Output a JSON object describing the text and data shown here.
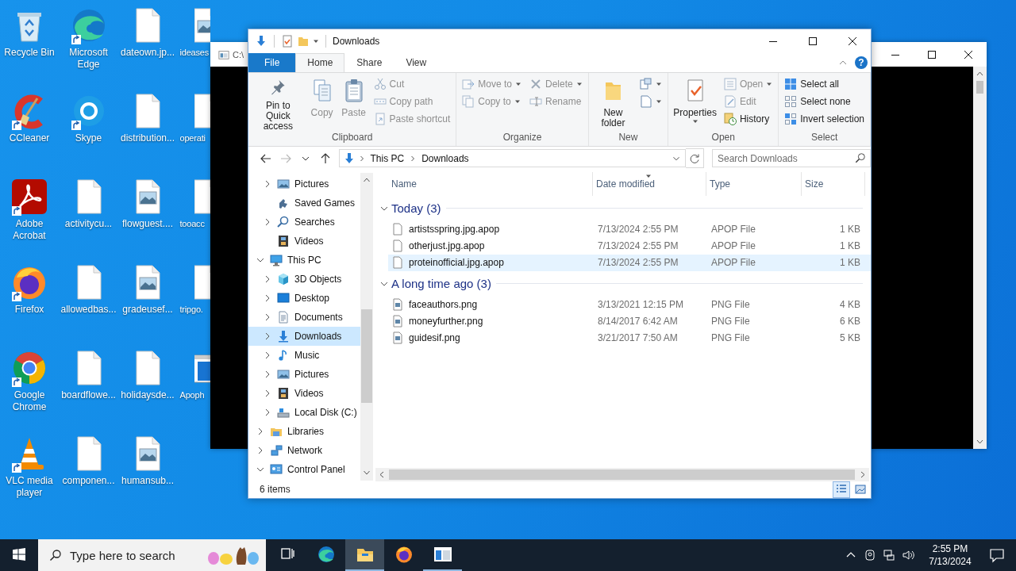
{
  "desktop_icons": [
    {
      "label": "Recycle Bin",
      "kind": "recycle-bin",
      "shortcut": false
    },
    {
      "label": "CCleaner",
      "kind": "ccleaner",
      "shortcut": true
    },
    {
      "label": "Adobe Acrobat",
      "kind": "acrobat",
      "shortcut": true
    },
    {
      "label": "Firefox",
      "kind": "firefox",
      "shortcut": true
    },
    {
      "label": "Google Chrome",
      "kind": "chrome",
      "shortcut": true
    },
    {
      "label": "VLC media player",
      "kind": "vlc",
      "shortcut": true
    },
    {
      "label": "Microsoft Edge",
      "kind": "edge",
      "shortcut": true
    },
    {
      "label": "Skype",
      "kind": "skype",
      "shortcut": true
    },
    {
      "label": "activitycu...",
      "kind": "file",
      "shortcut": false
    },
    {
      "label": "allowedbas...",
      "kind": "file",
      "shortcut": false
    },
    {
      "label": "boardflowe...",
      "kind": "file",
      "shortcut": false
    },
    {
      "label": "componen...",
      "kind": "file",
      "shortcut": false
    },
    {
      "label": "dateown.jp...",
      "kind": "file",
      "shortcut": false
    },
    {
      "label": "distribution...",
      "kind": "file",
      "shortcut": false
    },
    {
      "label": "flowguest....",
      "kind": "image-file",
      "shortcut": false
    },
    {
      "label": "gradeusef...",
      "kind": "image-file",
      "shortcut": false
    },
    {
      "label": "holidaysde...",
      "kind": "file",
      "shortcut": false
    },
    {
      "label": "humansub...",
      "kind": "image-file",
      "shortcut": false
    },
    {
      "label": "ideases",
      "kind": "image-file",
      "shortcut": false
    },
    {
      "label": "operati",
      "kind": "file",
      "shortcut": false
    },
    {
      "label": "tooacc",
      "kind": "file",
      "shortcut": false
    },
    {
      "label": "tripgo.",
      "kind": "file",
      "shortcut": false
    },
    {
      "label": "Apoph",
      "kind": "app-window",
      "shortcut": false
    }
  ],
  "console_window": {
    "title": "C:\\"
  },
  "explorer": {
    "title": "Downloads",
    "ribbon": {
      "tabs": [
        {
          "label": "File",
          "kind": "menu",
          "selected": false
        },
        {
          "label": "Home",
          "kind": "tab",
          "selected": true
        },
        {
          "label": "Share",
          "kind": "tab",
          "selected": false
        },
        {
          "label": "View",
          "kind": "tab",
          "selected": false
        }
      ],
      "help": "?",
      "groups": [
        {
          "label": "Clipboard",
          "large_buttons": [
            {
              "label": "Pin to Quick access",
              "kind": "pin",
              "disabled": false
            },
            {
              "label": "Copy",
              "kind": "copy",
              "disabled": true
            },
            {
              "label": "Paste",
              "kind": "paste",
              "disabled": true
            }
          ],
          "stacks": [
            [
              {
                "label": "Cut",
                "kind": "cut",
                "disabled": true
              },
              {
                "label": "Copy path",
                "kind": "copy-path",
                "disabled": true
              },
              {
                "label": "Paste shortcut",
                "kind": "paste-shortcut",
                "disabled": true
              }
            ]
          ]
        },
        {
          "label": "Organize",
          "stacks": [
            [
              {
                "label": "Move to",
                "kind": "move-to",
                "disabled": true,
                "dropdown": true
              },
              {
                "label": "Copy to",
                "kind": "copy-to",
                "disabled": true,
                "dropdown": true
              }
            ],
            [
              {
                "label": "Delete",
                "kind": "delete",
                "disabled": true,
                "dropdown": true
              },
              {
                "label": "Rename",
                "kind": "rename",
                "disabled": true
              }
            ]
          ]
        },
        {
          "label": "New",
          "large_buttons": [
            {
              "label": "New folder",
              "kind": "new-folder",
              "disabled": false
            }
          ],
          "stacks": [
            [
              {
                "kind": "new-item",
                "disabled": false,
                "dropdown": true
              },
              {
                "kind": "easy-access",
                "disabled": false,
                "dropdown": true
              }
            ]
          ]
        },
        {
          "label": "Open",
          "large_buttons": [
            {
              "label": "Properties",
              "kind": "properties",
              "disabled": false,
              "dropdown": true
            }
          ],
          "stacks": [
            [
              {
                "label": "Open",
                "kind": "open",
                "disabled": true,
                "dropdown": true
              },
              {
                "label": "Edit",
                "kind": "edit",
                "disabled": true
              },
              {
                "label": "History",
                "kind": "history",
                "disabled": false
              }
            ]
          ]
        },
        {
          "label": "Select",
          "stacks": [
            [
              {
                "label": "Select all",
                "kind": "select-all",
                "disabled": false
              },
              {
                "label": "Select none",
                "kind": "select-none",
                "disabled": false
              },
              {
                "label": "Invert selection",
                "kind": "invert",
                "disabled": false
              }
            ]
          ]
        }
      ]
    },
    "nav_buttons": [
      {
        "kind": "back",
        "disabled": false
      },
      {
        "kind": "forward",
        "disabled": true
      },
      {
        "kind": "recent",
        "disabled": false
      },
      {
        "kind": "up",
        "disabled": false
      }
    ],
    "address": {
      "crumbs": [
        "This PC",
        "Downloads"
      ]
    },
    "search": {
      "placeholder": "Search Downloads"
    },
    "nav_pane": {
      "top_children": [
        {
          "label": "Pictures",
          "kind": "pictures",
          "expanded": false,
          "selected": false
        },
        {
          "label": "Saved Games",
          "kind": "saved-games",
          "selected": false
        },
        {
          "label": "Searches",
          "kind": "searches",
          "expanded": false,
          "selected": false
        },
        {
          "label": "Videos",
          "kind": "videos",
          "selected": false
        }
      ],
      "items": [
        {
          "label": "This PC",
          "kind": "pc",
          "expanded": true,
          "selected": false,
          "children": [
            {
              "label": "3D Objects",
              "kind": "objects",
              "expanded": false,
              "selected": false
            },
            {
              "label": "Desktop",
              "kind": "desktop",
              "expanded": false,
              "selected": false
            },
            {
              "label": "Documents",
              "kind": "documents",
              "expanded": false,
              "selected": false
            },
            {
              "label": "Downloads",
              "kind": "downloads",
              "expanded": false,
              "selected": true
            },
            {
              "label": "Music",
              "kind": "music",
              "expanded": false,
              "selected": false
            },
            {
              "label": "Pictures",
              "kind": "pictures",
              "expanded": false,
              "selected": false
            },
            {
              "label": "Videos",
              "kind": "videos",
              "expanded": false,
              "selected": false
            },
            {
              "label": "Local Disk (C:)",
              "kind": "disk",
              "expanded": false,
              "selected": false
            }
          ]
        },
        {
          "label": "Libraries",
          "kind": "libraries",
          "expanded": false,
          "selected": false
        },
        {
          "label": "Network",
          "kind": "network",
          "expanded": false,
          "selected": false
        },
        {
          "label": "Control Panel",
          "kind": "control-panel",
          "expanded": true,
          "selected": false
        }
      ]
    },
    "columns": [
      {
        "label": "Name",
        "sorted": false
      },
      {
        "label": "Date modified",
        "sorted": true
      },
      {
        "label": "Type",
        "sorted": false
      },
      {
        "label": "Size",
        "sorted": false
      }
    ],
    "groups": [
      {
        "label": "Today (3)",
        "expanded": true,
        "rows": [
          {
            "name": "artistsspring.jpg.apop",
            "date": "7/13/2024 2:55 PM",
            "type": "APOP File",
            "size": "1 KB",
            "kind": "file",
            "selected": false
          },
          {
            "name": "otherjust.jpg.apop",
            "date": "7/13/2024 2:55 PM",
            "type": "APOP File",
            "size": "1 KB",
            "kind": "file",
            "selected": false
          },
          {
            "name": "proteinofficial.jpg.apop",
            "date": "7/13/2024 2:55 PM",
            "type": "APOP File",
            "size": "1 KB",
            "kind": "file",
            "selected": true
          }
        ]
      },
      {
        "label": "A long time ago (3)",
        "expanded": true,
        "rows": [
          {
            "name": "faceauthors.png",
            "date": "3/13/2021 12:15 PM",
            "type": "PNG File",
            "size": "4 KB",
            "kind": "image",
            "selected": false
          },
          {
            "name": "moneyfurther.png",
            "date": "8/14/2017 6:42 AM",
            "type": "PNG File",
            "size": "6 KB",
            "kind": "image",
            "selected": false
          },
          {
            "name": "guidesif.png",
            "date": "3/21/2017 7:50 AM",
            "type": "PNG File",
            "size": "5 KB",
            "kind": "image",
            "selected": false
          }
        ]
      }
    ],
    "status": "6 items",
    "view_buttons": [
      {
        "kind": "details",
        "selected": true
      },
      {
        "kind": "large-icons",
        "selected": false
      }
    ]
  },
  "taskbar": {
    "search_placeholder": "Type here to search",
    "apps": [
      {
        "kind": "task-view",
        "active": false,
        "running": false
      },
      {
        "kind": "edge",
        "active": false,
        "running": false
      },
      {
        "kind": "explorer",
        "active": true,
        "running": true
      },
      {
        "kind": "firefox",
        "active": false,
        "running": false
      },
      {
        "kind": "console",
        "active": false,
        "running": true
      }
    ],
    "time": "2:55 PM",
    "date": "7/13/2024"
  }
}
